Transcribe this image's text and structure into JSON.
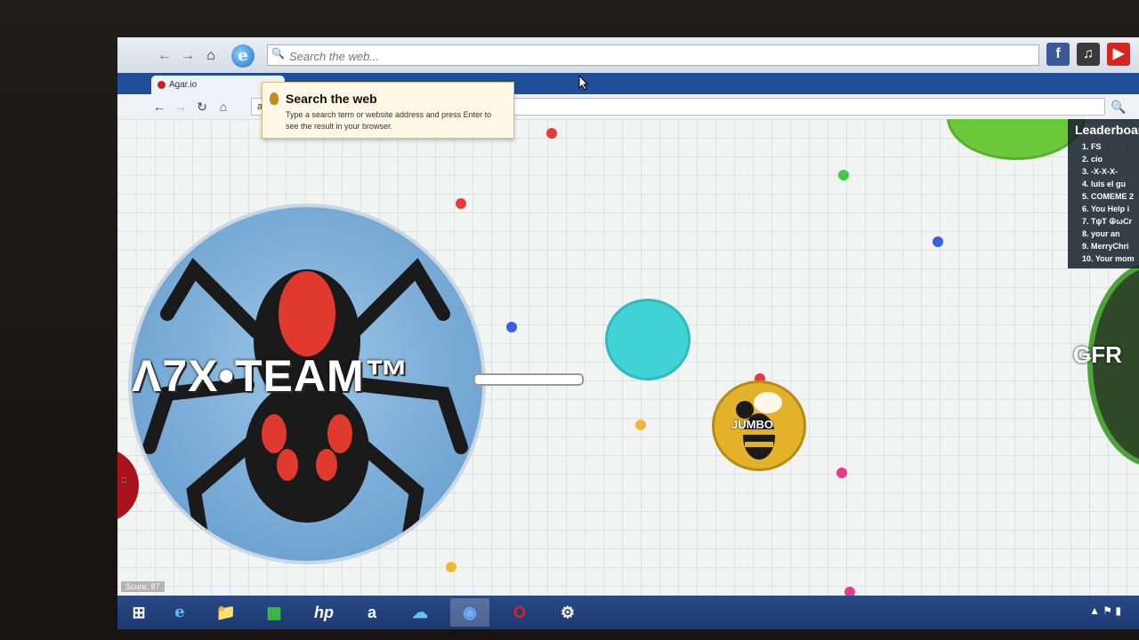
{
  "ie_toolbar": {
    "search_placeholder": "Search the web...",
    "back_icon": "back-arrow-icon",
    "forward_icon": "forward-arrow-icon",
    "home_icon": "home-icon"
  },
  "chrome": {
    "tab_title": "Agar.io",
    "address": "a"
  },
  "tooltip": {
    "title": "Search the web",
    "body": "Type a search term or website address and press Enter to see the result in your browser."
  },
  "game": {
    "big_cell_name": "Λ7X•TEAM™",
    "bee_cell_name": "JUMBO",
    "right_cell_name": "ǤFR",
    "left_edge_name": "::",
    "score": "Score: 87",
    "leaderboard_title": "Leaderboard",
    "leaderboard": [
      "1. FS",
      "2. cio",
      "3. -X-X-X-",
      "4. luis el gu",
      "5. COMEME 2",
      "6. You Help i",
      "7. TψT ☮ωCr",
      "8. your an",
      "9. MerryChri",
      "10. Your mom"
    ],
    "colors": {
      "spider_cell": "#6aa6d6",
      "teal_cell": "#3fd3d6",
      "green_cell": "#6ac83a",
      "bee_cell": "#e3b12a"
    }
  },
  "taskbar": {
    "items": [
      "windows-start",
      "internet-explorer",
      "file-explorer",
      "store",
      "hp",
      "amazon",
      "onedrive",
      "chrome",
      "opera",
      "steam"
    ]
  }
}
